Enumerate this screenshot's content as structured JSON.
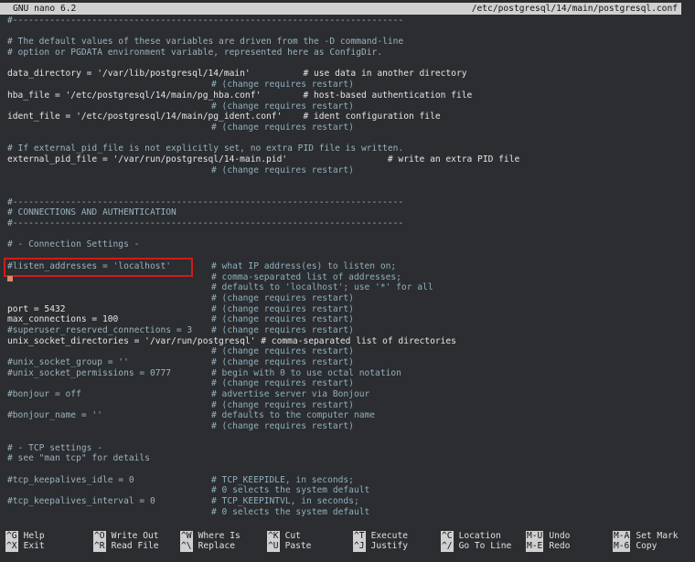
{
  "titlebar": {
    "app": "GNU nano 6.2",
    "file": "/etc/postgresql/14/main/postgresql.conf"
  },
  "lines": [
    {
      "code": "#--------------------------------------------------------------------------",
      "cmt": "",
      "style": "comment"
    },
    {
      "code": "",
      "cmt": "",
      "style": "normal"
    },
    {
      "code": "# The default values of these variables are driven from the -D command-line",
      "cmt": "",
      "style": "comment"
    },
    {
      "code": "# option or PGDATA environment variable, represented here as ConfigDir.",
      "cmt": "",
      "style": "comment"
    },
    {
      "code": "",
      "cmt": "",
      "style": "normal"
    },
    {
      "code": "data_directory = '/var/lib/postgresql/14/main'          # use data in another directory",
      "cmt": "",
      "style": "normal"
    },
    {
      "code": "",
      "cmt": "# (change requires restart)",
      "style": "comment"
    },
    {
      "code": "hba_file = '/etc/postgresql/14/main/pg_hba.conf'        # host-based authentication file",
      "cmt": "",
      "style": "normal"
    },
    {
      "code": "",
      "cmt": "# (change requires restart)",
      "style": "comment"
    },
    {
      "code": "ident_file = '/etc/postgresql/14/main/pg_ident.conf'    # ident configuration file",
      "cmt": "",
      "style": "normal"
    },
    {
      "code": "",
      "cmt": "# (change requires restart)",
      "style": "comment"
    },
    {
      "code": "",
      "cmt": "",
      "style": "normal"
    },
    {
      "code": "# If external_pid_file is not explicitly set, no extra PID file is written.",
      "cmt": "",
      "style": "comment"
    },
    {
      "code": "external_pid_file = '/var/run/postgresql/14-main.pid'                   # write an extra PID file",
      "cmt": "",
      "style": "normal"
    },
    {
      "code": "",
      "cmt": "# (change requires restart)",
      "style": "comment"
    },
    {
      "code": "",
      "cmt": "",
      "style": "normal"
    },
    {
      "code": "",
      "cmt": "",
      "style": "normal"
    },
    {
      "code": "#--------------------------------------------------------------------------",
      "cmt": "",
      "style": "comment"
    },
    {
      "code": "# CONNECTIONS AND AUTHENTICATION",
      "cmt": "",
      "style": "comment"
    },
    {
      "code": "#--------------------------------------------------------------------------",
      "cmt": "",
      "style": "comment"
    },
    {
      "code": "",
      "cmt": "",
      "style": "normal"
    },
    {
      "code": "# - Connection Settings -",
      "cmt": "",
      "style": "comment"
    },
    {
      "code": "",
      "cmt": "",
      "style": "normal"
    },
    {
      "code": "#listen_addresses = 'localhost'",
      "cmt": "# what IP address(es) to listen on;",
      "style": "comment"
    },
    {
      "code": "",
      "cmt": "# comma-separated list of addresses;",
      "style": "comment"
    },
    {
      "code": "",
      "cmt": "# defaults to 'localhost'; use '*' for all",
      "style": "comment"
    },
    {
      "code": "",
      "cmt": "# (change requires restart)",
      "style": "comment"
    },
    {
      "code": "port = 5432",
      "cmt": "# (change requires restart)",
      "style": "normal"
    },
    {
      "code": "max_connections = 100",
      "cmt": "# (change requires restart)",
      "style": "normal"
    },
    {
      "code": "#superuser_reserved_connections = 3",
      "cmt": "# (change requires restart)",
      "style": "comment"
    },
    {
      "code": "unix_socket_directories = '/var/run/postgresql' # comma-separated list of directories",
      "cmt": "",
      "style": "normal"
    },
    {
      "code": "",
      "cmt": "# (change requires restart)",
      "style": "comment"
    },
    {
      "code": "#unix_socket_group = ''",
      "cmt": "# (change requires restart)",
      "style": "comment"
    },
    {
      "code": "#unix_socket_permissions = 0777",
      "cmt": "# begin with 0 to use octal notation",
      "style": "comment"
    },
    {
      "code": "",
      "cmt": "# (change requires restart)",
      "style": "comment"
    },
    {
      "code": "#bonjour = off",
      "cmt": "# advertise server via Bonjour",
      "style": "comment"
    },
    {
      "code": "",
      "cmt": "# (change requires restart)",
      "style": "comment"
    },
    {
      "code": "#bonjour_name = ''",
      "cmt": "# defaults to the computer name",
      "style": "comment"
    },
    {
      "code": "",
      "cmt": "# (change requires restart)",
      "style": "comment"
    },
    {
      "code": "",
      "cmt": "",
      "style": "normal"
    },
    {
      "code": "# - TCP settings -",
      "cmt": "",
      "style": "comment"
    },
    {
      "code": "# see \"man tcp\" for details",
      "cmt": "",
      "style": "comment"
    },
    {
      "code": "",
      "cmt": "",
      "style": "normal"
    },
    {
      "code": "#tcp_keepalives_idle = 0",
      "cmt": "# TCP_KEEPIDLE, in seconds;",
      "style": "comment"
    },
    {
      "code": "",
      "cmt": "# 0 selects the system default",
      "style": "comment"
    },
    {
      "code": "#tcp_keepalives_interval = 0",
      "cmt": "# TCP_KEEPINTVL, in seconds;",
      "style": "comment"
    },
    {
      "code": "",
      "cmt": "# 0 selects the system default",
      "style": "comment"
    }
  ],
  "shortcuts": [
    {
      "key": "^G",
      "label": "Help"
    },
    {
      "key": "^X",
      "label": "Exit"
    },
    {
      "key": "^O",
      "label": "Write Out"
    },
    {
      "key": "^R",
      "label": "Read File"
    },
    {
      "key": "^W",
      "label": "Where Is"
    },
    {
      "key": "^\\",
      "label": "Replace"
    },
    {
      "key": "^K",
      "label": "Cut"
    },
    {
      "key": "^U",
      "label": "Paste"
    },
    {
      "key": "^T",
      "label": "Execute"
    },
    {
      "key": "^J",
      "label": "Justify"
    },
    {
      "key": "^C",
      "label": "Location"
    },
    {
      "key": "^/",
      "label": "Go To Line"
    },
    {
      "key": "M-U",
      "label": "Undo"
    },
    {
      "key": "M-E",
      "label": "Redo"
    },
    {
      "key": "M-A",
      "label": "Set Mark"
    },
    {
      "key": "M-6",
      "label": "Copy"
    }
  ]
}
